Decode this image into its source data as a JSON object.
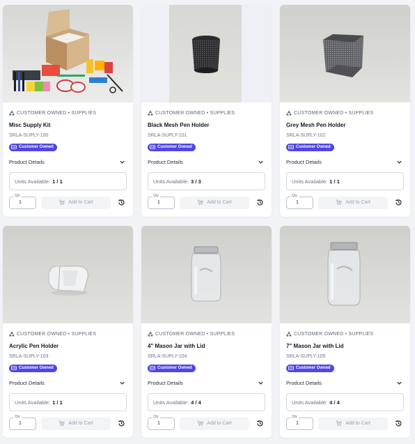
{
  "cards": [
    {
      "category": "CUSTOMER OWNED • SUPPLIES",
      "title": "Misc Supply Kit",
      "sku": "SRLA-SUPLY-100",
      "badge": "Customer Owned",
      "details_label": "Product Details",
      "units_label": "Units Available:",
      "units_value": "1 / 1",
      "qty_label": "Qty",
      "qty_value": "1",
      "cart_label": "Add to Cart",
      "image": "misc-supply-kit"
    },
    {
      "category": "CUSTOMER OWNED • SUPPLIES",
      "title": "Black Mesh Pen Holder",
      "sku": "SRLA-SUPLY-101",
      "badge": "Customer Owned",
      "details_label": "Product Details",
      "units_label": "Units Available:",
      "units_value": "3 / 3",
      "qty_label": "Qty",
      "qty_value": "1",
      "cart_label": "Add to Cart",
      "image": "black-mesh-pen-holder"
    },
    {
      "category": "CUSTOMER OWNED • SUPPLIES",
      "title": "Grey Mesh Pen Holder",
      "sku": "SRLA-SUPLY-102",
      "badge": "Customer Owned",
      "details_label": "Product Details",
      "units_label": "Units Available:",
      "units_value": "1 / 1",
      "qty_label": "Qty",
      "qty_value": "1",
      "cart_label": "Add to Cart",
      "image": "grey-mesh-pen-holder"
    },
    {
      "category": "CUSTOMER OWNED • SUPPLIES",
      "title": "Acrylic Pen Holder",
      "sku": "SRLA-SUPLY-103",
      "badge": "Customer Owned",
      "details_label": "Product Details",
      "units_label": "Units Available:",
      "units_value": "1 / 1",
      "qty_label": "Qty",
      "qty_value": "1",
      "cart_label": "Add to Cart",
      "image": "acrylic-pen-holder"
    },
    {
      "category": "CUSTOMER OWNED • SUPPLIES",
      "title": "4\" Mason Jar with Lid",
      "sku": "SRLA-SUPLY-104",
      "badge": "Customer Owned",
      "details_label": "Product Details",
      "units_label": "Units Available:",
      "units_value": "4 / 4",
      "qty_label": "Qty",
      "qty_value": "1",
      "cart_label": "Add to Cart",
      "image": "mason-jar-4in"
    },
    {
      "category": "CUSTOMER OWNED • SUPPLIES",
      "title": "7\" Mason Jar with Lid",
      "sku": "SRLA-SUPLY-105",
      "badge": "Customer Owned",
      "details_label": "Product Details",
      "units_label": "Units Available:",
      "units_value": "4 / 4",
      "qty_label": "Qty",
      "qty_value": "1",
      "cart_label": "Add to Cart",
      "image": "mason-jar-7in"
    }
  ],
  "colors": {
    "badge": "#4f46e5",
    "card": "#ffffff",
    "page": "#f1f3f6",
    "muted_button": "#f3f4f6"
  }
}
